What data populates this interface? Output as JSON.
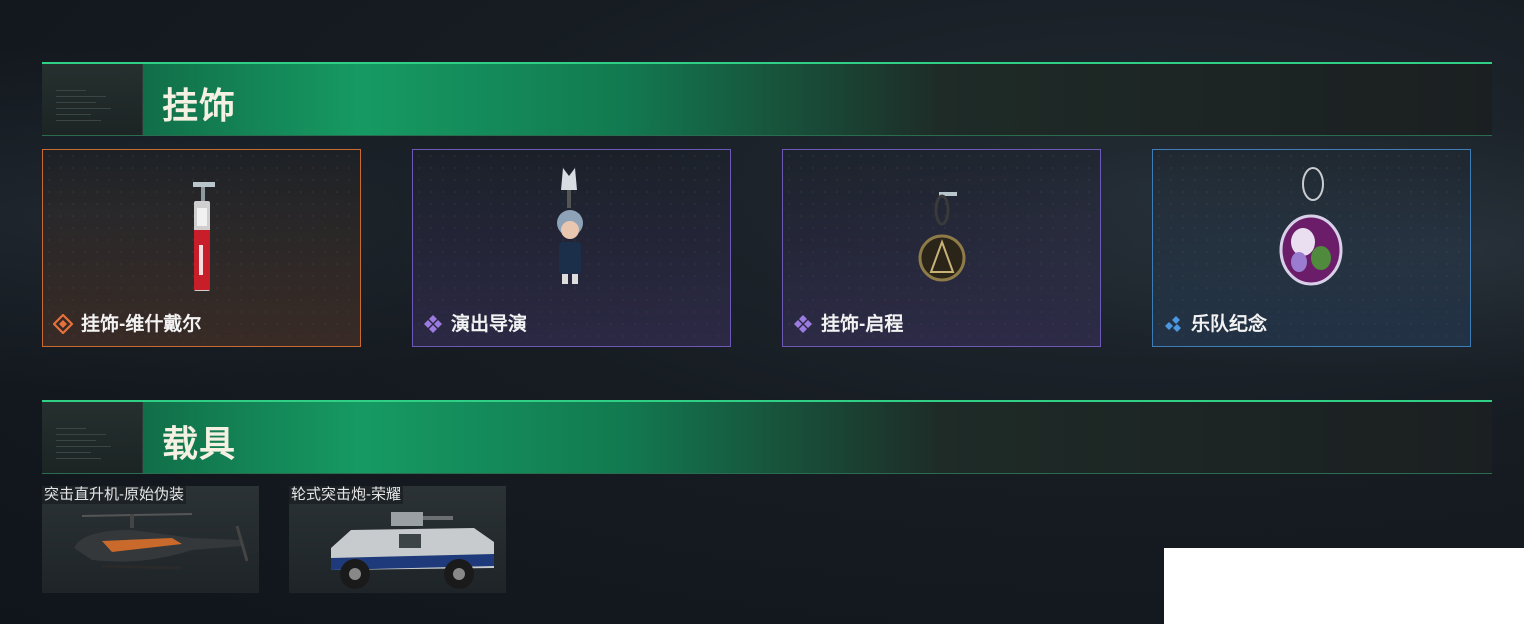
{
  "sections": [
    {
      "title": "挂饰"
    },
    {
      "title": "载具"
    }
  ],
  "charms": [
    {
      "label": "挂饰-维什戴尔",
      "rarity": "orange",
      "rarity_color": "#e8703a",
      "icon": "charm-flask-icon"
    },
    {
      "label": "演出导演",
      "rarity": "purple",
      "rarity_color": "#9b7be0",
      "icon": "charm-figure-icon"
    },
    {
      "label": "挂饰-启程",
      "rarity": "purple",
      "rarity_color": "#9b7be0",
      "icon": "charm-medal-icon"
    },
    {
      "label": "乐队纪念",
      "rarity": "blue",
      "rarity_color": "#4b97e0",
      "icon": "charm-badge-icon"
    }
  ],
  "vehicles": [
    {
      "label": "突击直升机-原始伪装",
      "icon": "helicopter-icon"
    },
    {
      "label": "轮式突击炮-荣耀",
      "icon": "armored-vehicle-icon"
    }
  ],
  "colors": {
    "accent_green": "#2fcf86",
    "orange": "#c76b33",
    "purple": "#6d58b8",
    "blue": "#3f7db8"
  }
}
